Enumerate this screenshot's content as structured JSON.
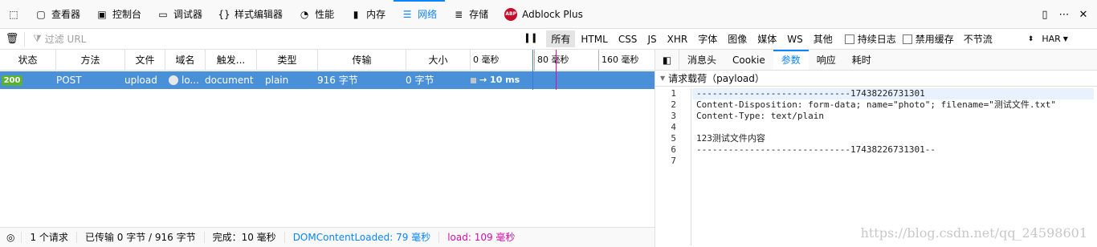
{
  "toolbox": {
    "tabs": [
      {
        "label": "查看器",
        "icon": "inspector-icon"
      },
      {
        "label": "控制台",
        "icon": "console-icon"
      },
      {
        "label": "调试器",
        "icon": "debugger-icon"
      },
      {
        "label": "样式编辑器",
        "icon": "style-editor-icon"
      },
      {
        "label": "性能",
        "icon": "performance-icon"
      },
      {
        "label": "内存",
        "icon": "memory-icon"
      },
      {
        "label": "网络",
        "icon": "network-icon"
      },
      {
        "label": "存储",
        "icon": "storage-icon"
      },
      {
        "label": "Adblock Plus",
        "icon": "adblock-plus-icon"
      }
    ],
    "active_tab": "网络",
    "abp_text": "ABP"
  },
  "filter": {
    "placeholder": "过滤 URL",
    "types": [
      "所有",
      "HTML",
      "CSS",
      "JS",
      "XHR",
      "字体",
      "图像",
      "媒体",
      "WS",
      "其他"
    ],
    "selected_type": "所有",
    "persist_logs": "持续日志",
    "disable_cache": "禁用缓存",
    "throttle": "不节流",
    "har": "HAR"
  },
  "columns": [
    "状态",
    "方法",
    "文件",
    "域名",
    "触发...",
    "类型",
    "传输",
    "大小"
  ],
  "timeline_ticks": [
    "0 毫秒",
    "80 毫秒",
    "160 毫秒"
  ],
  "request": {
    "status": "200",
    "method": "POST",
    "file": "upload",
    "domain": "lo...",
    "cause": "document",
    "type": "plain",
    "transferred": "916 字节",
    "size": "0 字节",
    "timing": "→ 10 ms"
  },
  "details": {
    "tabs": [
      "消息头",
      "Cookie",
      "参数",
      "响应",
      "耗时"
    ],
    "active_tab": "参数",
    "section_title": "请求载荷（payload）",
    "lines": [
      "-----------------------------17438226731301",
      "Content-Disposition: form-data; name=\"photo\"; filename=\"测试文件.txt\"",
      "Content-Type: text/plain",
      "",
      "123测试文件内容",
      "-----------------------------17438226731301--",
      ""
    ]
  },
  "statusbar": {
    "requests": "1 个请求",
    "transferred": "已传输 0 字节 / 916 字节",
    "finish": "完成：10 毫秒",
    "dom_content_loaded": "DOMContentLoaded: 79 毫秒",
    "load": "load: 109 毫秒"
  },
  "watermark": "https://blog.csdn.net/qq_24598601",
  "colors": {
    "accent": "#0a84ff",
    "selected_row": "#4a90d9",
    "status_ok": "#58b133",
    "load_line": "#d70fa8",
    "dom_line": "#0a84ff"
  }
}
